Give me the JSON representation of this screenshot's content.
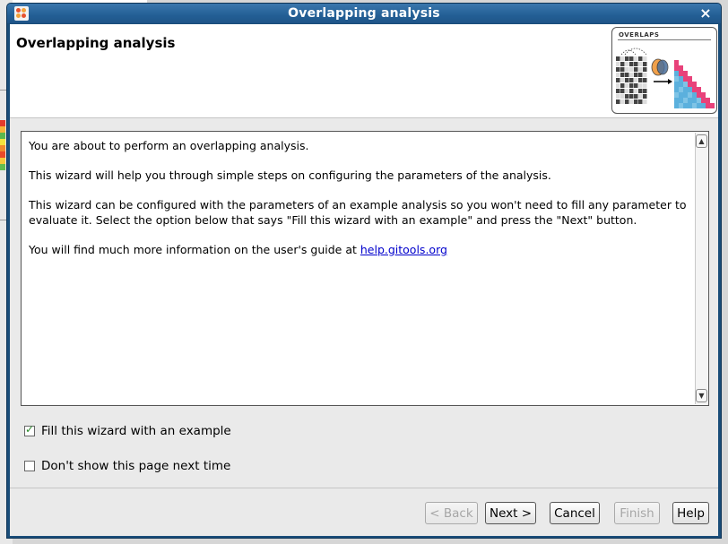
{
  "window": {
    "title": "Overlapping analysis",
    "close_glyph": "×"
  },
  "header": {
    "title": "Overlapping analysis",
    "logo_text": "OVERLAPS"
  },
  "description": {
    "para1": "You are about to perform an overlapping analysis.",
    "para2": "This wizard will help you through simple steps on configuring the parameters of the analysis.",
    "para3": "This wizard can be configured with the parameters of an example analysis so you won't need to fill any parameter to evaluate it. Select the option below that says \"Fill this wizard with an example\" and press the \"Next\" button.",
    "para4_prefix": "You will find much more information on the user's guide at ",
    "para4_link": "help.gitools.org"
  },
  "options": {
    "fill_example_label": "Fill this wizard with an example",
    "fill_example_checked": true,
    "dont_show_label": "Don't show this page next time",
    "dont_show_checked": false
  },
  "buttons": {
    "back": "< Back",
    "next": "Next >",
    "cancel": "Cancel",
    "finish": "Finish",
    "help": "Help"
  },
  "icons": {
    "app": "gitools-app-icon",
    "close": "close-icon",
    "scroll_up": "scroll-up-arrow-icon",
    "scroll_down": "scroll-down-arrow-icon",
    "checked": "checkmark-icon"
  },
  "colors": {
    "titlebar": "#235f95",
    "link": "#0000cc",
    "check": "#2a8a2a"
  }
}
